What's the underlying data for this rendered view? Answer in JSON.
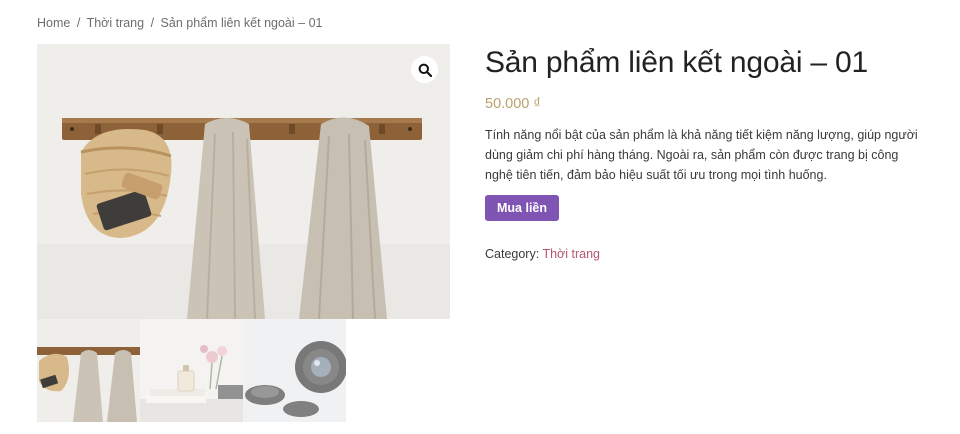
{
  "breadcrumb": {
    "home": "Home",
    "separator": "/",
    "category": "Thời trang",
    "current": "Sản phẩm liên kết ngoài – 01"
  },
  "gallery": {
    "main_image": "towels-on-wall-hooks-with-basket",
    "zoom_icon": "magnifier-icon",
    "thumbnails": [
      "towels-on-wall-hooks-with-basket",
      "flowers-and-perfume-on-books",
      "camera-lenses"
    ]
  },
  "product": {
    "title": "Sản phẩm liên kết ngoài – 01",
    "price": "50.000 ₫",
    "description": "Tính năng nổi bật của sản phẩm là khả năng tiết kiệm năng lượng, giúp người dùng giảm chi phí hàng tháng. Ngoài ra, sản phẩm còn được trang bị công nghệ tiên tiến, đảm bảo hiệu suất tối ưu trong mọi tình huống.",
    "buy_label": "Mua liền",
    "category_label": "Category:",
    "category_value": "Thời trang"
  },
  "colors": {
    "button": "#7f54b3",
    "price": "#b9a16b",
    "category_link": "#b5566d"
  }
}
